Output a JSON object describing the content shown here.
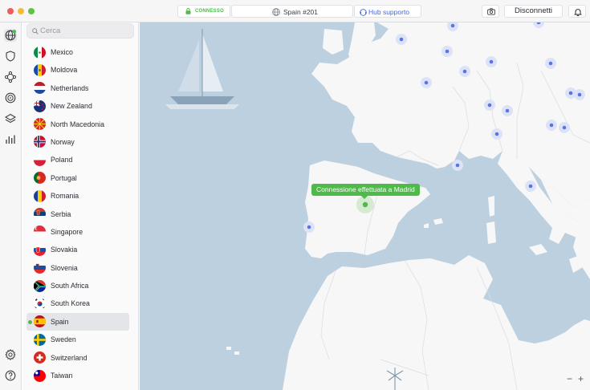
{
  "titlebar": {
    "status": "CONNESSO",
    "server": "Spain #201",
    "support": "Hub supporto",
    "disconnect": "Disconnetti"
  },
  "rail": {
    "icons": [
      "globe-icon",
      "shield-icon",
      "meshnet-icon",
      "target-icon",
      "layers-icon",
      "stats-icon",
      "settings-icon",
      "help-icon"
    ]
  },
  "search": {
    "placeholder": "Cerca",
    "value": ""
  },
  "countries": [
    {
      "name": "Mexico",
      "flag": "mx"
    },
    {
      "name": "Moldova",
      "flag": "md"
    },
    {
      "name": "Netherlands",
      "flag": "nl"
    },
    {
      "name": "New Zealand",
      "flag": "nz"
    },
    {
      "name": "North Macedonia",
      "flag": "mk"
    },
    {
      "name": "Norway",
      "flag": "no"
    },
    {
      "name": "Poland",
      "flag": "pl"
    },
    {
      "name": "Portugal",
      "flag": "pt"
    },
    {
      "name": "Romania",
      "flag": "ro"
    },
    {
      "name": "Serbia",
      "flag": "rs"
    },
    {
      "name": "Singapore",
      "flag": "sg"
    },
    {
      "name": "Slovakia",
      "flag": "sk"
    },
    {
      "name": "Slovenia",
      "flag": "si"
    },
    {
      "name": "South Africa",
      "flag": "za"
    },
    {
      "name": "South Korea",
      "flag": "kr"
    },
    {
      "name": "Spain",
      "flag": "es",
      "selected": true,
      "connected": true
    },
    {
      "name": "Sweden",
      "flag": "se"
    },
    {
      "name": "Switzerland",
      "flag": "ch"
    },
    {
      "name": "Taiwan",
      "flag": "tw"
    }
  ],
  "map": {
    "tooltip": "Connessione effettuata a Madrid",
    "zoom_out": "−",
    "zoom_in": "+"
  },
  "colors": {
    "connected": "#4fb94a",
    "sea": "#bdd0df",
    "land": "#f7f7f8",
    "server_dot": "#5a73e6",
    "link": "#4467e0"
  }
}
